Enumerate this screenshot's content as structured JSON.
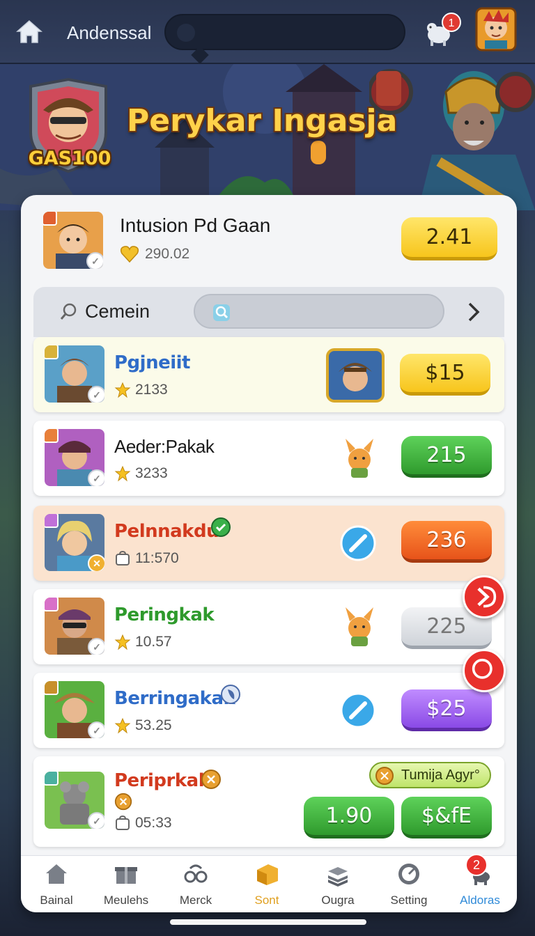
{
  "header": {
    "title": "Andenssal",
    "notification_count": "1"
  },
  "hero": {
    "badge": "GAS100",
    "title": "Perykar Ingasja"
  },
  "featured": {
    "name": "Intusion Pd Gaan",
    "sub_value": "290.02",
    "button_label": "2.41"
  },
  "search": {
    "label": "Cemein",
    "placeholder": ""
  },
  "rows": [
    {
      "name": "Pgjneiit",
      "name_color": "#2f6cc8",
      "sub_value": "2133",
      "sub_icon": "star-icon",
      "price": "$15",
      "price_style": "yellow",
      "row_bg": "#fbfbe9",
      "tag_color": "#d8b23a"
    },
    {
      "name": "Aeder:Pakak",
      "name_color": "#1a1a1a",
      "sub_value": "3233",
      "sub_icon": "star-icon",
      "price": "215",
      "price_style": "green",
      "row_bg": "#ffffff",
      "tag_color": "#e8803a"
    },
    {
      "name": "Pelnnakdu",
      "name_color": "#d23a1e",
      "sub_value": "11:570",
      "sub_icon": "bag-icon",
      "price": "236",
      "price_style": "orange",
      "row_bg": "#fbe3cf",
      "tag_color": "#c070d8"
    },
    {
      "name": "Peringkak",
      "name_color": "#2e9a2c",
      "sub_value": "10.57",
      "sub_icon": "star-icon",
      "price": "225",
      "price_style": "gray",
      "row_bg": "#ffffff",
      "tag_color": "#d870c8"
    },
    {
      "name": "Berringakak",
      "name_color": "#2f6cc8",
      "sub_value": "53.25",
      "sub_icon": "star-icon",
      "price": "$25",
      "price_style": "purple",
      "row_bg": "#ffffff",
      "tag_color": "#c8902a"
    },
    {
      "name": "Periprkak",
      "name_color": "#d23a1e",
      "sub_value": "05:33",
      "sub_icon": "bag-icon",
      "tag_label": "Tumija Agyr°",
      "price": "1.90",
      "price_style": "green",
      "price2": "$&fE",
      "price2_style": "green",
      "row_bg": "#ffffff",
      "tag_color": "#4ab0a0"
    }
  ],
  "nav": [
    {
      "label": "Bainal",
      "icon": "home-icon"
    },
    {
      "label": "Meulehs",
      "icon": "gift-icon"
    },
    {
      "label": "Merck",
      "icon": "glasses-icon"
    },
    {
      "label": "Sont",
      "icon": "box-icon",
      "active": true
    },
    {
      "label": "Ougra",
      "icon": "stack-icon"
    },
    {
      "label": "Setting",
      "icon": "gauge-icon"
    },
    {
      "label": "Aldoras",
      "icon": "dog-icon",
      "highlight": true
    }
  ],
  "nav_badge": "2",
  "colors": {
    "accent_yellow": "#f7c51c",
    "accent_green": "#2f9a2d",
    "accent_orange": "#e7531a",
    "accent_purple": "#8a4ae6",
    "badge_red": "#e8302c",
    "nav_active": "#e0a020",
    "nav_highlight": "#2f8ad8"
  }
}
